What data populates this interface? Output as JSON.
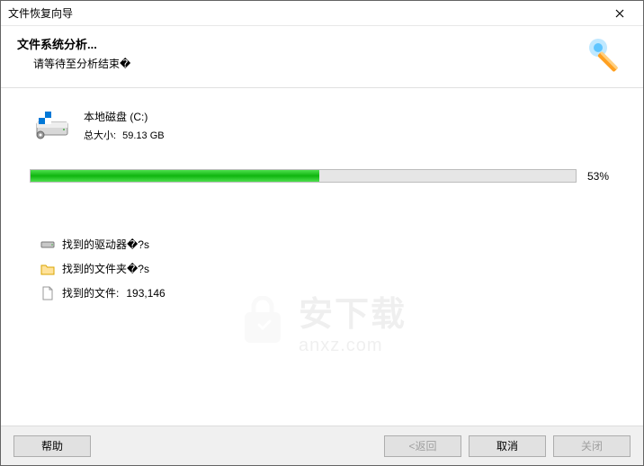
{
  "window": {
    "title": "文件恢复向导"
  },
  "header": {
    "title": "文件系统分析...",
    "subtitle": "请等待至分析结束�"
  },
  "disk": {
    "name": "本地磁盘 (C:)",
    "size_label": "总大小:",
    "size_value": "59.13 GB"
  },
  "progress": {
    "percent": 53,
    "percent_text": "53%"
  },
  "stats": {
    "drives_label": "找到的驱动器�?s",
    "folders_label": "找到的文件夹�?s",
    "files_label": "找到的文件:",
    "files_value": "193,146"
  },
  "watermark": {
    "main": "安下载",
    "sub": "anxz.com"
  },
  "footer": {
    "help": "帮助",
    "back": "<返回",
    "cancel": "取消",
    "close": "关闭"
  }
}
